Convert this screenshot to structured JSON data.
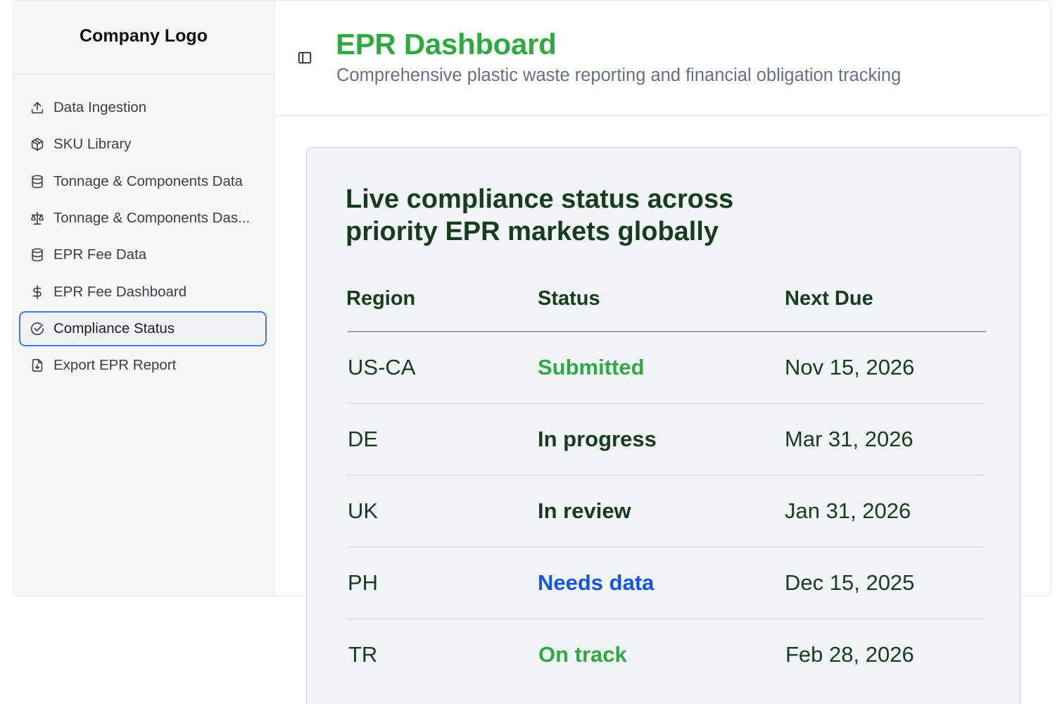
{
  "sidebar": {
    "logo": "Company Logo",
    "items": [
      {
        "label": "Data Ingestion",
        "icon": "upload-icon"
      },
      {
        "label": "SKU Library",
        "icon": "package-icon"
      },
      {
        "label": "Tonnage & Components Data",
        "icon": "database-icon"
      },
      {
        "label": "Tonnage & Components Das...",
        "icon": "scale-icon"
      },
      {
        "label": "EPR Fee Data",
        "icon": "database-icon"
      },
      {
        "label": "EPR Fee Dashboard",
        "icon": "dollar-icon"
      },
      {
        "label": "Compliance Status",
        "icon": "check-circle-icon",
        "active": true
      },
      {
        "label": "Export EPR Report",
        "icon": "file-download-icon"
      }
    ]
  },
  "header": {
    "title": "EPR Dashboard",
    "subtitle": "Comprehensive plastic waste reporting and financial obligation tracking"
  },
  "card": {
    "title": "Live compliance status across priority EPR markets globally",
    "columns": [
      "Region",
      "Status",
      "Next Due"
    ],
    "rows": [
      {
        "region": "US-CA",
        "status": "Submitted",
        "due": "Nov 15, 2026",
        "status_color": "#2eaa41"
      },
      {
        "region": "DE",
        "status": "In progress",
        "due": "Mar 31, 2026",
        "status_color": "#183c1e"
      },
      {
        "region": "UK",
        "status": "In review",
        "due": "Jan 31, 2026",
        "status_color": "#183c1e"
      },
      {
        "region": "PH",
        "status": "Needs data",
        "due": "Dec 15, 2025",
        "status_color": "#1556e0"
      },
      {
        "region": "TR",
        "status": "On track",
        "due": "Feb 28, 2026",
        "status_color": "#2eaa41"
      }
    ]
  },
  "colors": {
    "accent_green": "#2eaa41",
    "dark_green": "#183c1e",
    "link_blue": "#1556e0",
    "active_border": "#3d7ee6"
  }
}
